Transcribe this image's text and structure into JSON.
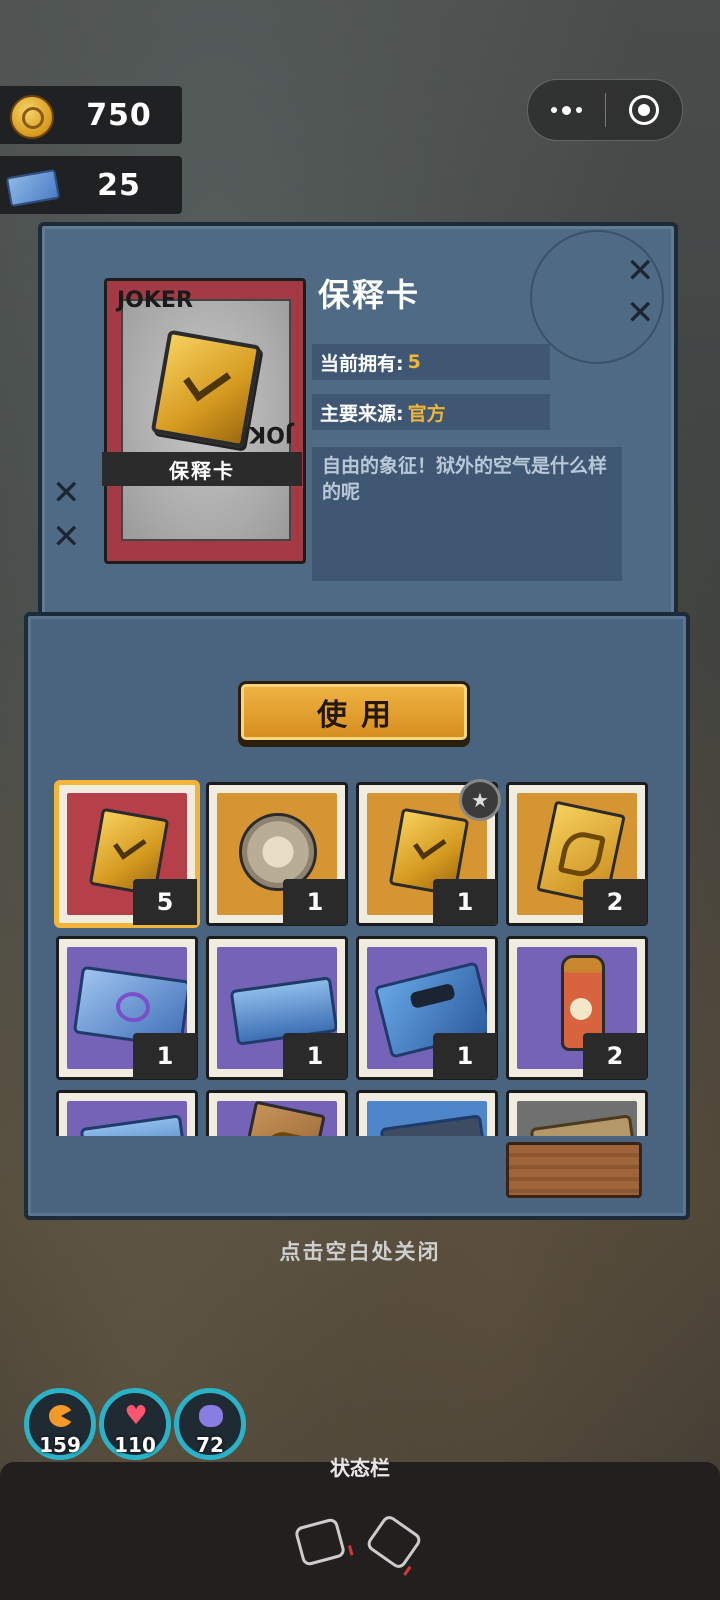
{
  "currency": {
    "coins": "750",
    "tickets": "25",
    "coin_icon": "coin-icon",
    "ticket_icon": "ticket-icon"
  },
  "miniprogram_menu": {
    "more_icon": "more-dots-icon",
    "close_icon": "target-close-icon"
  },
  "item": {
    "name": "保释卡",
    "card_label": "保释卡",
    "joker_text": "JOKER",
    "owned_label": "当前拥有:",
    "owned_value": "5",
    "source_label": "主要来源:",
    "source_value": "官方",
    "description": "自由的象征！狱外的空气是什么样的呢"
  },
  "use_button": "使用",
  "inventory": [
    {
      "icon": "bail-card-icon",
      "bg": "red",
      "count": "5",
      "selected": true
    },
    {
      "icon": "film-reel-icon",
      "bg": "orange",
      "count": "1"
    },
    {
      "icon": "bail-card-star-icon",
      "bg": "orange",
      "count": "1"
    },
    {
      "icon": "gold-card-icon",
      "bg": "orange",
      "count": "2"
    },
    {
      "icon": "toy-ticket-icon",
      "bg": "purple",
      "count": "1"
    },
    {
      "icon": "blue-box-icon",
      "bg": "purple",
      "count": "1"
    },
    {
      "icon": "sunglasses-card-icon",
      "bg": "purple",
      "count": "1"
    },
    {
      "icon": "sauce-bottle-icon",
      "bg": "purple",
      "count": "2"
    },
    {
      "icon": "blue-item-icon",
      "bg": "purple",
      "count": ""
    },
    {
      "icon": "pastry-icon",
      "bg": "purple",
      "count": ""
    },
    {
      "icon": "blue-item-2-icon",
      "bg": "blue",
      "count": ""
    },
    {
      "icon": "paper-bag-icon",
      "bg": "gray",
      "count": ""
    }
  ],
  "close_hint": "点击空白处关闭",
  "stats": {
    "hunger": "159",
    "health": "110",
    "sanity": "72"
  },
  "status_bar": {
    "title": "状态栏"
  },
  "colors": {
    "accent_gold": "#f2b537",
    "panel_blue": "#4f6a85",
    "stat_ring": "#2ab3c8"
  }
}
